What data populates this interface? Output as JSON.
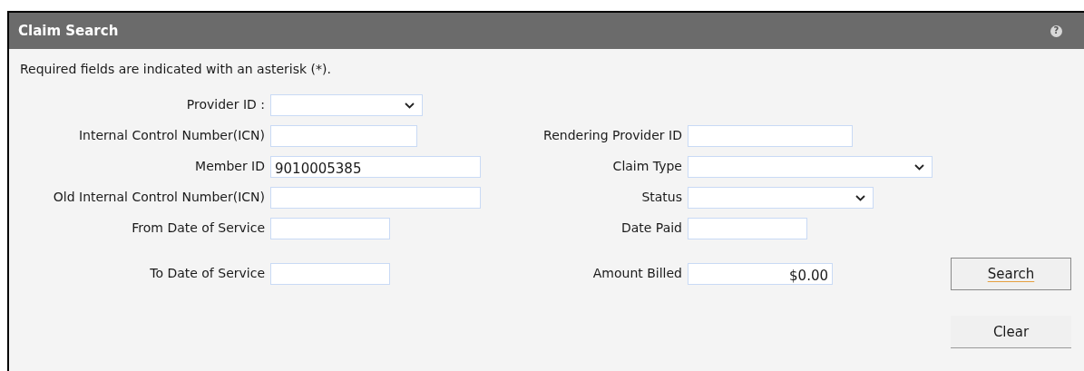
{
  "panel": {
    "title": "Claim Search",
    "help": "?"
  },
  "note": "Required fields are indicated with an asterisk (*).",
  "left_fields": [
    {
      "label": "Provider ID :",
      "kind": "select"
    },
    {
      "label": "Internal Control Number(ICN)",
      "kind": "text"
    },
    {
      "label": "Member ID",
      "kind": "text",
      "value": "9010005385"
    },
    {
      "label": "Old Internal Control Number(ICN)",
      "kind": "text"
    },
    {
      "label": "From Date of Service",
      "kind": "text"
    },
    {
      "label": "To Date of Service",
      "kind": "text"
    }
  ],
  "right_fields": [
    {
      "label": "Rendering Provider ID",
      "kind": "text"
    },
    {
      "label": "Claim Type",
      "kind": "select"
    },
    {
      "label": "Status",
      "kind": "select"
    },
    {
      "label": "Date Paid",
      "kind": "text"
    },
    {
      "label": "Amount Billed",
      "kind": "amount",
      "value": "$0.00"
    }
  ],
  "buttons": [
    "Search",
    "Clear"
  ]
}
